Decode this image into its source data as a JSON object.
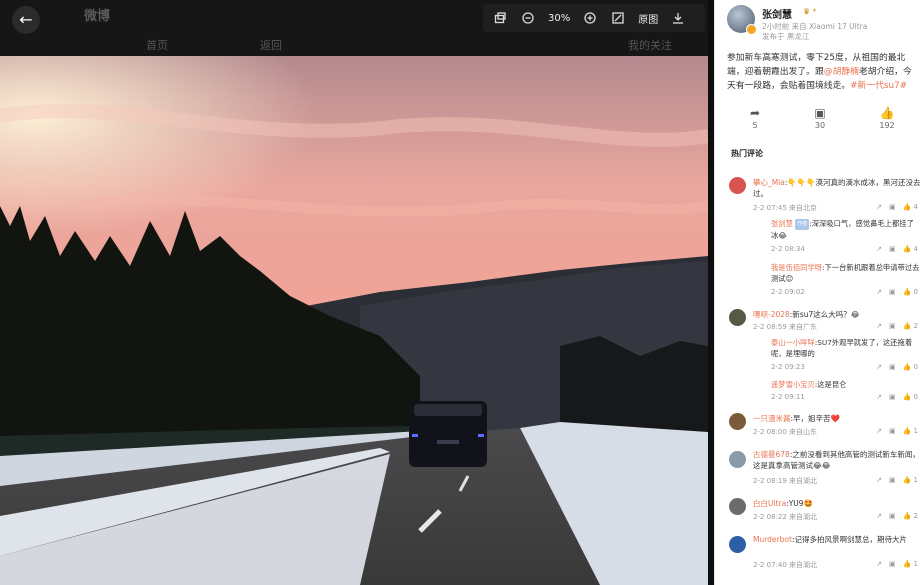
{
  "background_site": {
    "logo": "微博",
    "tab_home": "首页",
    "tab_back": "返回",
    "tab_right": "我的关注"
  },
  "toolbar": {
    "zoom": "30%",
    "original_label": "原图"
  },
  "post": {
    "author": "张剑慧",
    "author_badge": "♛ ⁴",
    "meta_line1": "2小时前 来自 Xiaomi 17 Ultra",
    "meta_line2": "发布于 黑龙江",
    "text_a": "参加新车高寒测试，零下25度，从祖国的最北端，迎着朝霞出发了。跟",
    "mention": "@胡静楠",
    "text_b": "老胡介绍，今天有一段路，会贴着国境线走。",
    "hashtag": "#新一代su7#",
    "shares": "5",
    "comments": "30",
    "likes": "192"
  },
  "hot_comments_title": "热门评论",
  "comments": [
    {
      "name": "攀心_Mia",
      "text": ":👇👇👇漠河真的滴水成冰，黑河还没去过。",
      "meta": "2-2 07:45 来自北京",
      "likes": "4"
    },
    {
      "name": "张剑慧",
      "tag": "作者",
      "text": ":深深吸口气，感觉鼻毛上都挂了冰😂",
      "meta": "2-2 08:34",
      "likes": "4"
    },
    {
      "name": "我是伍佰同学呀",
      "text": ":下一台新机跟着总申请带过去测试😊",
      "meta": "2-2 09:02",
      "likes": "0"
    },
    {
      "name": "嘿呗-2028",
      "text": ":新su7这么大吗？😂",
      "meta": "2-2 08:59 来自广东",
      "likes": "2"
    },
    {
      "name": "泰山一小咩咩",
      "text": ":SU7外观早就发了，这还拖着呢，是埋哪的",
      "meta": "2-2 09:23",
      "likes": "0"
    },
    {
      "name": "遥梦雪小宝贝",
      "text": ":这是昆仑",
      "meta": "2-2 09:11",
      "likes": "0"
    },
    {
      "name": "一只漫米酱",
      "text": ":早，姐辛苦❤️",
      "meta": "2-2 08:00 来自山东",
      "likes": "1"
    },
    {
      "name": "古德曼678",
      "text": ":之前没看到其他高管的测试新车新闻，这是真拿高管测试😂😂",
      "meta": "2-2 08:19 来自湖北",
      "likes": "1"
    },
    {
      "name": "白白Ultra",
      "text": ":YU9🤩",
      "meta": "2-2 08:22 来自湖北",
      "likes": "2"
    },
    {
      "name": "Murderbot",
      "text": ":记得多拍风景啊剑慧总，期待大片",
      "meta": "2-2 07:40 来自湖北",
      "likes": "1"
    }
  ]
}
